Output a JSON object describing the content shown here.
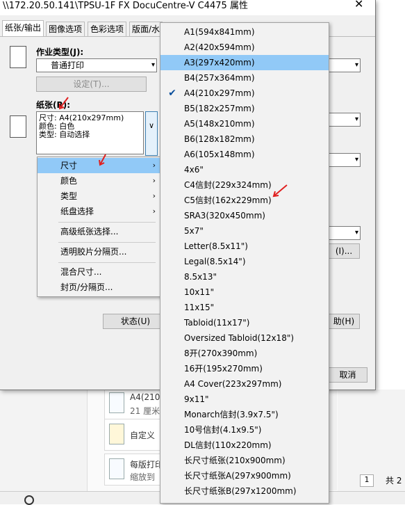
{
  "dialog": {
    "title": "\\\\172.20.50.141\\TPSU-1F FX DocuCentre-V C4475 属性",
    "tabs": [
      "纸张/输出",
      "图像选项",
      "色彩选项",
      "版面/水"
    ],
    "job_type_label": "作业类型(J):",
    "job_type_value": "普通打印",
    "settings_button": "设定(T)...",
    "paper_label": "纸张(R):",
    "paper_info": [
      "尺寸: A4(210x297mm)",
      "颜色: 白色",
      "类型: 自动选择"
    ],
    "status_button": "状态(U)",
    "right_button_partial": "(I)...",
    "help_button_partial": "助(H)",
    "cancel_button": "取消"
  },
  "context_menu": {
    "items": [
      {
        "label": "尺寸",
        "submenu": true
      },
      {
        "label": "颜色",
        "submenu": true
      },
      {
        "label": "类型",
        "submenu": true
      },
      {
        "label": "纸盘选择",
        "submenu": true
      },
      {
        "label": "高级纸张选择...",
        "submenu": false
      },
      {
        "label": "透明胶片分隔页...",
        "submenu": false
      },
      {
        "label": "混合尺寸...",
        "submenu": false
      },
      {
        "label": "封页/分隔页...",
        "submenu": false
      }
    ],
    "submenu_glyph": "›"
  },
  "size_menu": {
    "selected": "A3(297x420mm)",
    "checked": "A4(210x297mm)",
    "check_glyph": "✔",
    "items": [
      "A1(594x841mm)",
      "A2(420x594mm)",
      "A3(297x420mm)",
      "B4(257x364mm)",
      "A4(210x297mm)",
      "B5(182x257mm)",
      "A5(148x210mm)",
      "B6(128x182mm)",
      "A6(105x148mm)",
      "4x6\"",
      "C4信封(229x324mm)",
      "C5信封(162x229mm)",
      "SRA3(320x450mm)",
      "5x7\"",
      "Letter(8.5x11\")",
      "Legal(8.5x14\")",
      "8.5x13\"",
      "10x11\"",
      "11x15\"",
      "Tabloid(11x17\")",
      "Oversized Tabloid(12x18\")",
      "8开(270x390mm)",
      "16开(195x270mm)",
      "A4 Cover(223x297mm)",
      "9x11\"",
      "Monarch信封(3.9x7.5\")",
      "10号信封(4.1x9.5\")",
      "DL信封(110x220mm)",
      "长尺寸纸张(210x900mm)",
      "长尺寸纸张A(297x900mm)",
      "长尺寸纸张B(297x1200mm)"
    ]
  },
  "background": {
    "item1_line1": "A4(210",
    "item1_line2": "21 厘米",
    "item2": "自定义",
    "item3_line1": "每版打印",
    "item3_line2": "缩放到",
    "page_count": "共 2",
    "page_num": "1"
  },
  "colors": {
    "highlight": "#91c9f7",
    "arrow": "#e02020"
  }
}
